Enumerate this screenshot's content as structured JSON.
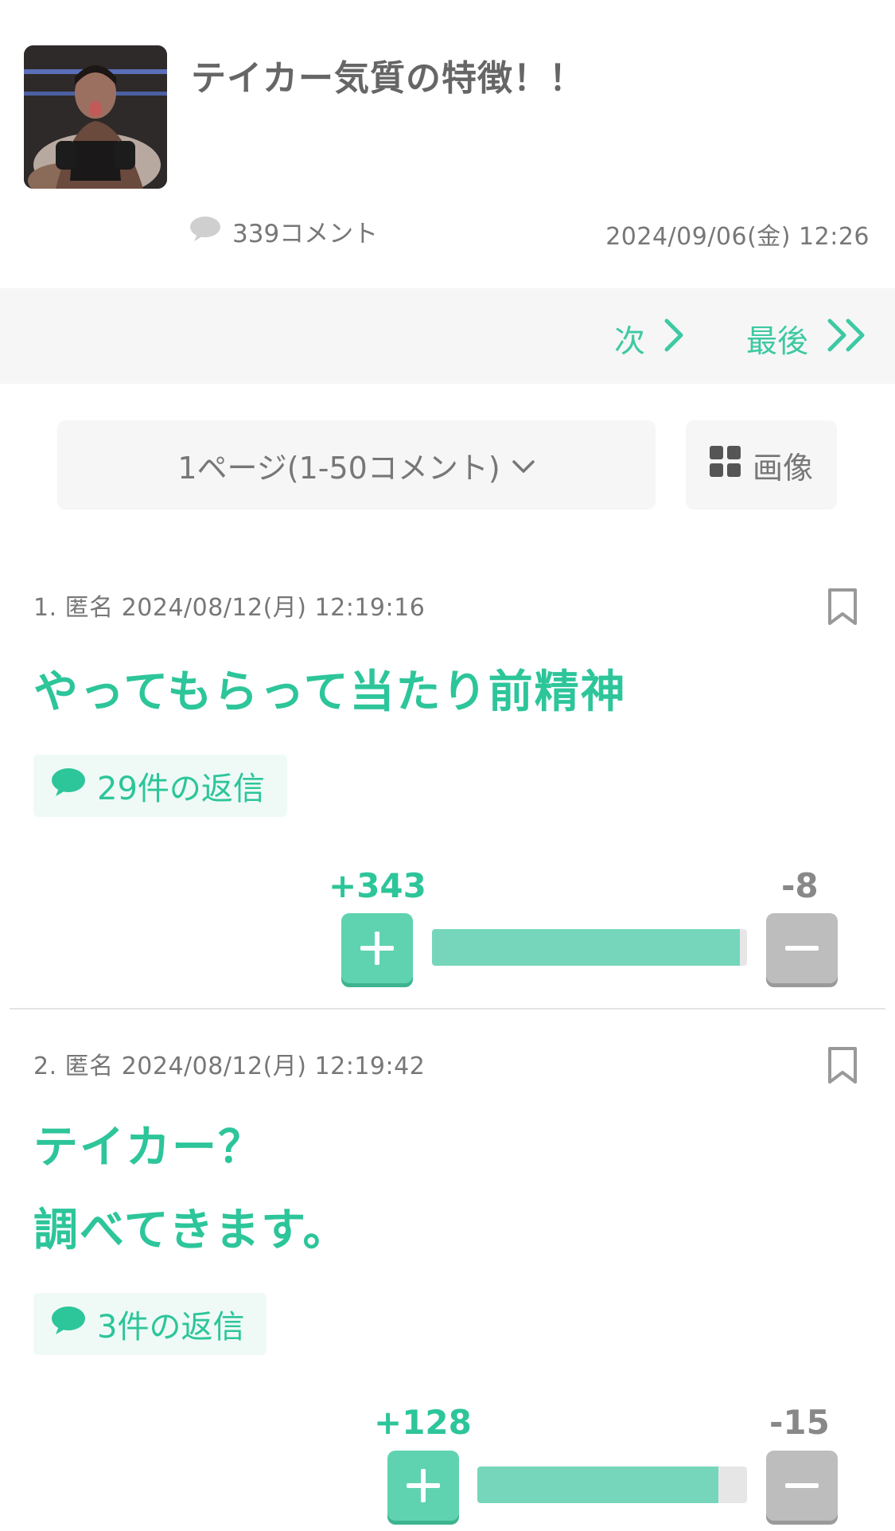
{
  "topic": {
    "title": "テイカー気質の特徴！！",
    "comment_count": "339コメント",
    "date": "2024/09/06(金) 12:26"
  },
  "pager": {
    "next_label": "次",
    "last_label": "最後"
  },
  "page_select": {
    "value": "1ページ(1-50コメント)",
    "image_label": "画像"
  },
  "comments": [
    {
      "meta": "1. 匿名 2024/08/12(月) 12:19:16",
      "body": "やってもらって当たり前精神",
      "replies": "29件の返信",
      "plus": "+343",
      "minus": "-8",
      "plus_ratio": 0.977
    },
    {
      "meta": "2. 匿名 2024/08/12(月) 12:19:42",
      "body_lines": [
        "テイカー？",
        "調べてきます。"
      ],
      "replies": "3件の返信",
      "plus": "+128",
      "minus": "-15",
      "plus_ratio": 0.895
    }
  ],
  "colors": {
    "accent": "#2dc59a",
    "vote_fill": "#75d6bb",
    "minus_button": "#bdbdbd"
  }
}
